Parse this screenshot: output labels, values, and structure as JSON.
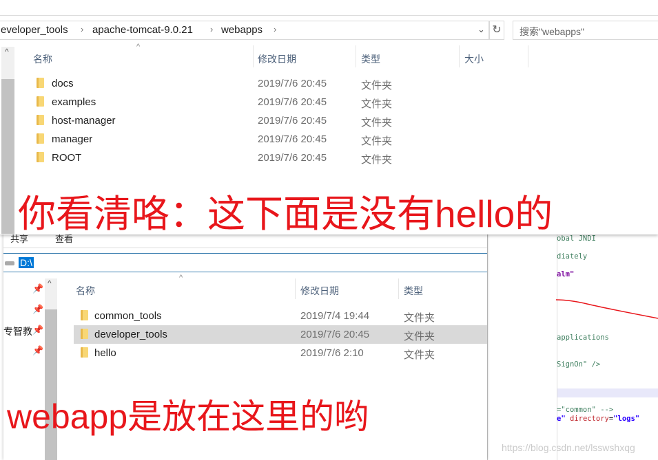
{
  "top_window": {
    "breadcrumb": [
      "eveloper_tools",
      "apache-tomcat-9.0.21",
      "webapps"
    ],
    "search_placeholder": "搜索\"webapps\"",
    "columns": {
      "name": "名称",
      "date": "修改日期",
      "type": "类型",
      "size": "大小"
    },
    "rows": [
      {
        "name": "docs",
        "date": "2019/7/6 20:45",
        "type": "文件夹"
      },
      {
        "name": "examples",
        "date": "2019/7/6 20:45",
        "type": "文件夹"
      },
      {
        "name": "host-manager",
        "date": "2019/7/6 20:45",
        "type": "文件夹"
      },
      {
        "name": "manager",
        "date": "2019/7/6 20:45",
        "type": "文件夹"
      },
      {
        "name": "ROOT",
        "date": "2019/7/6 20:45",
        "type": "文件夹"
      }
    ],
    "annotation": "你看清咯：这下面是没有hello的"
  },
  "bottom_window": {
    "ribbon_tabs": [
      "共享",
      "查看"
    ],
    "address": "D:\\",
    "nav_item": "专智教",
    "columns": {
      "name": "名称",
      "date": "修改日期",
      "type": "类型"
    },
    "rows": [
      {
        "name": "common_tools",
        "date": "2019/7/4 19:44",
        "type": "文件夹"
      },
      {
        "name": "developer_tools",
        "date": "2019/7/6 20:45",
        "type": "文件夹",
        "selected": true
      },
      {
        "name": "hello",
        "date": "2019/7/6 2:10",
        "type": "文件夹"
      }
    ],
    "annotation": "webapp是放在这里的哟"
  },
  "code_editor": {
    "lines": [
      "obal JNDI",
      "diately",
      "alm\"",
      "applications",
      "SignOn\" />",
      "=\"common\" -->"
    ],
    "last_line": {
      "a": "e\"",
      "b": " directory",
      "c": "=",
      "d": "\"logs\""
    }
  },
  "watermark": "https://blog.csdn.net/lsswshxqg",
  "colors": {
    "annotation": "#e8161b",
    "selection": "#d9d9d9",
    "accent": "#0078d7"
  }
}
